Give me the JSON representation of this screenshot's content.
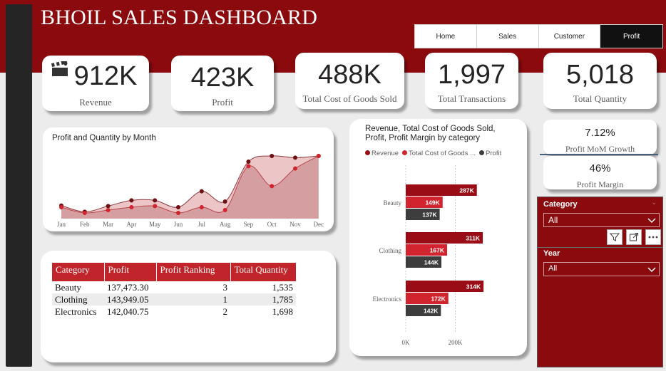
{
  "header": {
    "title": "BHOIL SALES DASHBOARD",
    "nav": [
      {
        "label": "Home"
      },
      {
        "label": "Sales"
      },
      {
        "label": "Customer"
      },
      {
        "label": "Profit"
      }
    ],
    "active_nav": "Profit"
  },
  "kpis": [
    {
      "value": "912K",
      "label": "Revenue",
      "icon": "clapperboard-icon"
    },
    {
      "value": "423K",
      "label": "Profit"
    },
    {
      "value": "488K",
      "label": "Total Cost of Goods Sold"
    },
    {
      "value": "1,997",
      "label": "Total Transactions"
    },
    {
      "value": "5,018",
      "label": "Total Quantity"
    }
  ],
  "mini_kpis": [
    {
      "value": "7.12%",
      "label": "Profit MoM Growth"
    },
    {
      "value": "46%",
      "label": "Profit Margin"
    }
  ],
  "monthly_chart": {
    "title": "Profit and Quantity by Month"
  },
  "category_chart": {
    "title_line1": "Revenue, Total Cost of Goods Sold,",
    "title_line2": "Profit, Profit Margin by category",
    "legend": [
      "Revenue",
      "Total Cost of Goods ...",
      "Profit"
    ]
  },
  "table": {
    "headers": [
      "Category",
      "Profit",
      "Profit Ranking",
      "Total Quantity"
    ],
    "rows": [
      [
        "Beauty",
        "137,473.30",
        "3",
        "1,535"
      ],
      [
        "Clothing",
        "143,949.05",
        "1",
        "1,785"
      ],
      [
        "Electronics",
        "142,040.75",
        "2",
        "1,698"
      ]
    ]
  },
  "slicers": {
    "category": {
      "title": "Category",
      "value": "All"
    },
    "year": {
      "title": "Year",
      "value": "All"
    }
  },
  "colors": {
    "brand": "#8b0a0e",
    "revenue": "#9b0d16",
    "cost": "#d1242f",
    "profit": "#3d3d3d",
    "area_profit": "#d39a9c",
    "area_quantity": "#ecc6c7"
  },
  "chart_data": [
    {
      "type": "area",
      "title": "Profit and Quantity by Month",
      "categories": [
        "Jan",
        "Feb",
        "Mar",
        "Apr",
        "May",
        "Jun",
        "Jul",
        "Aug",
        "Sep",
        "Oct",
        "Nov",
        "Dec"
      ],
      "series": [
        {
          "values": [
            20,
            10,
            15,
            20,
            22,
            10,
            20,
            15,
            92,
            57,
            88,
            110
          ]
        },
        {
          "values": [
            23,
            12,
            22,
            32,
            32,
            20,
            48,
            30,
            100,
            110,
            107,
            110
          ]
        }
      ],
      "ylim": [
        0,
        120
      ],
      "grid": false
    },
    {
      "type": "bar",
      "orientation": "horizontal",
      "title": "Revenue, Total Cost of Goods Sold, Profit, Profit Margin by category",
      "categories": [
        "Beauty",
        "Clothing",
        "Electronics"
      ],
      "series": [
        {
          "name": "Revenue",
          "values": [
            287,
            311,
            314
          ],
          "labels": [
            "287K",
            "311K",
            "314K"
          ]
        },
        {
          "name": "Total Cost of Goods Sold",
          "values": [
            149,
            167,
            172
          ],
          "labels": [
            "149K",
            "167K",
            "172K"
          ]
        },
        {
          "name": "Profit",
          "values": [
            137,
            144,
            142
          ],
          "labels": [
            "137K",
            "144K",
            "142K"
          ]
        }
      ],
      "x_ticks": [
        "0K",
        "200K"
      ],
      "xlim": [
        0,
        400
      ],
      "legend": "top-left"
    }
  ]
}
